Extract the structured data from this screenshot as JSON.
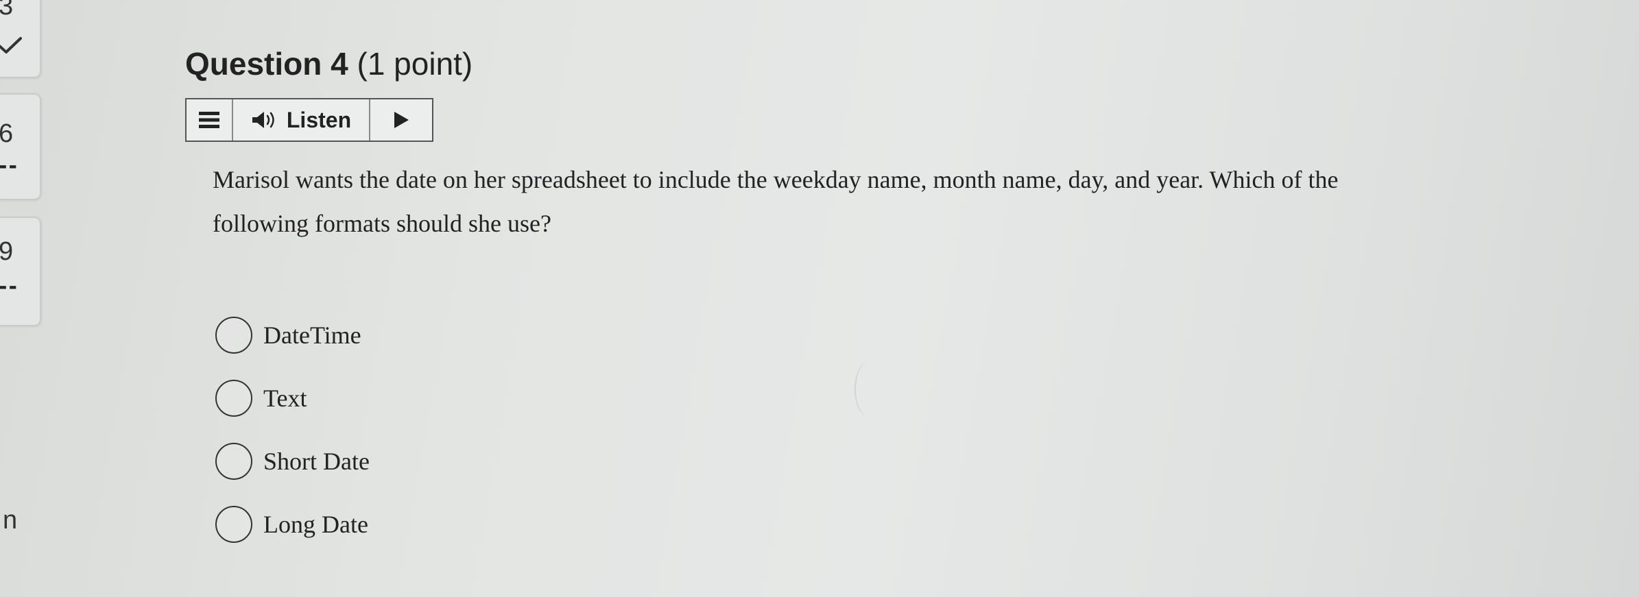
{
  "nav": {
    "items": [
      {
        "number": "3",
        "status_icon": "check-icon"
      },
      {
        "number": "6",
        "status": "--"
      },
      {
        "number": "9",
        "status": "--"
      }
    ],
    "partial_label": "n"
  },
  "question": {
    "title": "Question 4",
    "points": "(1 point)",
    "text": "Marisol wants the date on her spreadsheet to include the weekday name, month name, day, and year. Which of the following formats should she use?"
  },
  "audio_toolbar": {
    "menu_icon": "menu-icon",
    "speaker_icon": "speaker-icon",
    "listen_label": "Listen",
    "play_icon": "play-icon"
  },
  "options": [
    {
      "label": "DateTime",
      "selected": false
    },
    {
      "label": "Text",
      "selected": false
    },
    {
      "label": "Short Date",
      "selected": false
    },
    {
      "label": "Long Date",
      "selected": false
    }
  ]
}
